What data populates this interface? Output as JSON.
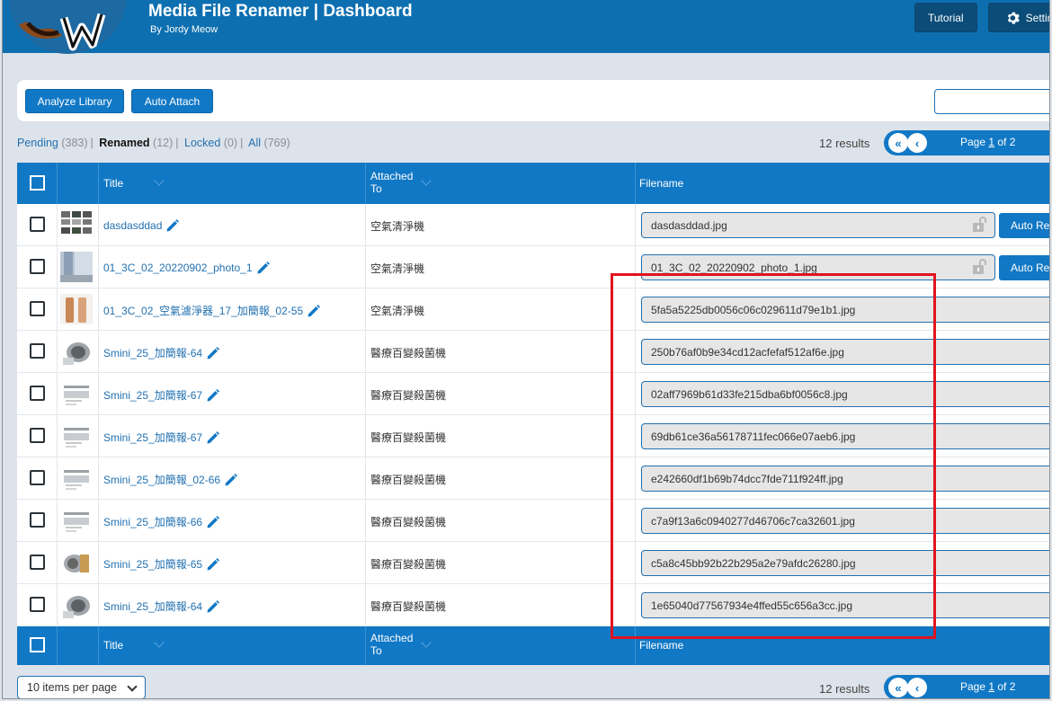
{
  "header": {
    "title": "Media File Renamer | Dashboard",
    "subtitle": "By Jordy Meow",
    "tutorial_label": "Tutorial",
    "settings_label": "Settings"
  },
  "toolbar": {
    "analyze_label": "Analyze Library",
    "auto_attach_label": "Auto Attach",
    "search_value": ""
  },
  "filters": [
    {
      "label": "Pending",
      "count": "(383)",
      "active": false
    },
    {
      "label": "Renamed",
      "count": "(12)",
      "active": true
    },
    {
      "label": "Locked",
      "count": "(0)",
      "active": false
    },
    {
      "label": "All",
      "count": "(769)",
      "active": false
    }
  ],
  "pagination": {
    "results_text": "12 results",
    "page_prefix": "Page ",
    "current_page": "1",
    "page_suffix": " of 2"
  },
  "columns": {
    "title": "Title",
    "attached_line1": "Attached",
    "attached_line2": "To",
    "filename": "Filename"
  },
  "rows": [
    {
      "title": "dasdasddad",
      "attached": "空氣清淨機",
      "filename": "dasdasddad.jpg",
      "locked": true,
      "auto": "Auto Re",
      "thumb": "grid"
    },
    {
      "title": "01_3C_02_20220902_photo_1",
      "attached": "空氣清淨機",
      "filename": "01_3C_02_20220902_photo_1.jpg",
      "locked": true,
      "auto": "Auto Re",
      "thumb": "window"
    },
    {
      "title": "01_3C_02_空氣濾淨器_17_加簡報_02-55",
      "attached": "空氣清淨機",
      "filename": "5fa5a5225db0056c06c029611d79e1b1.jpg",
      "locked": false,
      "thumb": "copper"
    },
    {
      "title": "Smini_25_加簡報-64",
      "attached": "醫療百變殺菌機",
      "filename": "250b76af0b9e34cd12acfefaf512af6e.jpg",
      "locked": false,
      "thumb": "device"
    },
    {
      "title": "Smini_25_加簡報-67",
      "attached": "醫療百變殺菌機",
      "filename": "02aff7969b61d33fe215dba6bf0056c8.jpg",
      "locked": false,
      "thumb": "doc"
    },
    {
      "title": "Smini_25_加簡報-67",
      "attached": "醫療百變殺菌機",
      "filename": "69db61ce36a56178711fec066e07aeb6.jpg",
      "locked": false,
      "thumb": "doc"
    },
    {
      "title": "Smini_25_加簡報_02-66",
      "attached": "醫療百變殺菌機",
      "filename": "e242660df1b69b74dcc7fde711f924ff.jpg",
      "locked": false,
      "thumb": "doc"
    },
    {
      "title": "Smini_25_加簡報-66",
      "attached": "醫療百變殺菌機",
      "filename": "c7a9f13a6c0940277d46706c7ca32601.jpg",
      "locked": false,
      "thumb": "doc"
    },
    {
      "title": "Smini_25_加簡報-65",
      "attached": "醫療百變殺菌機",
      "filename": "c5a8c45bb92b22b295a2e79afdc26280.jpg",
      "locked": false,
      "thumb": "gold"
    },
    {
      "title": "Smini_25_加簡報-64",
      "attached": "醫療百變殺菌機",
      "filename": "1e65040d77567934e4ffed55c656a3cc.jpg",
      "locked": false,
      "thumb": "device"
    }
  ],
  "per_page": "10 items per page",
  "colors": {
    "primary": "#1178c5",
    "header": "#0d6fb0",
    "link": "#2271b1",
    "highlight": "#e0141e"
  }
}
